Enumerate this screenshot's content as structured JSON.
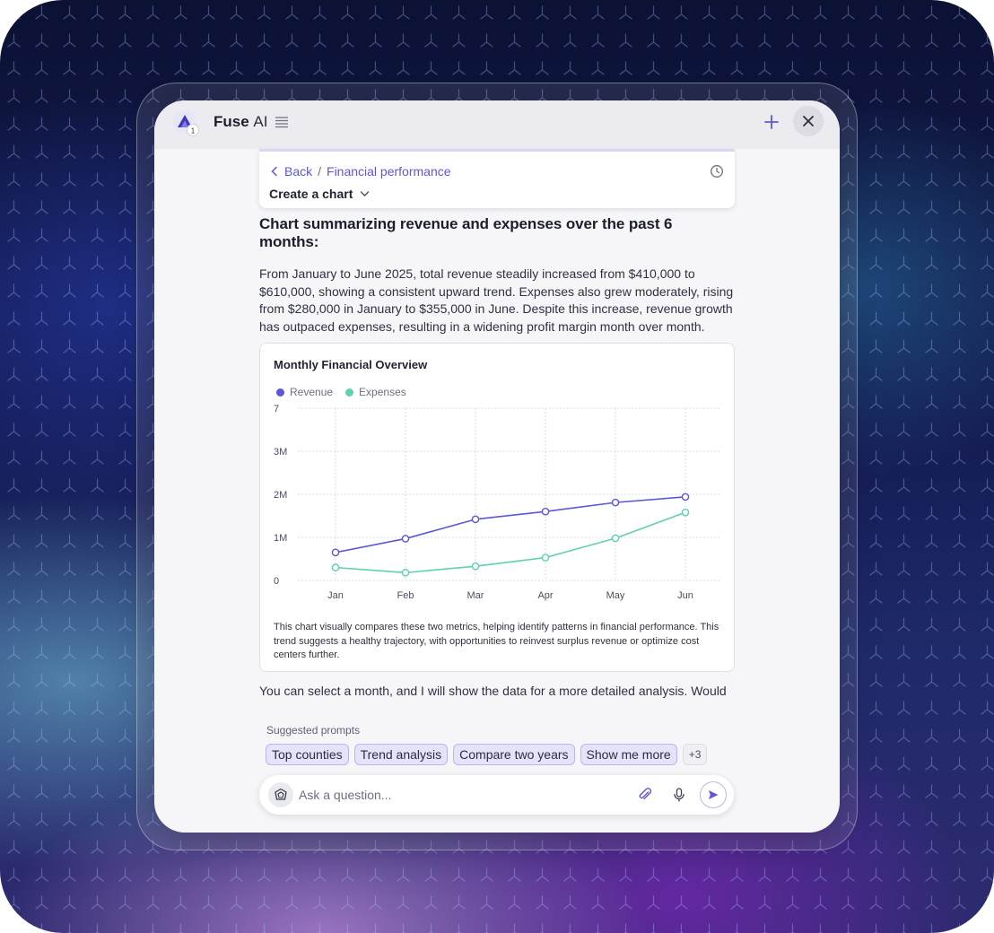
{
  "app": {
    "name_bold": "Fuse",
    "name_light": "AI",
    "logo_badge": "1"
  },
  "breadcrumb": {
    "back_label": "Back",
    "separator": "/",
    "current": "Financial performance",
    "subtitle": "Create a chart"
  },
  "message": {
    "heading": "Chart summarizing revenue and expenses over the past 6 months:",
    "paragraph": "From January to June 2025, total revenue steadily increased from $410,000 to $610,000, showing a consistent upward trend. Expenses also grew moderately, rising from $280,000 in January to $355,000 in June. Despite this increase, revenue growth has outpaced expenses, resulting in a widening profit margin month over month.",
    "followup": "You can select a month, and I will show the data for a more detailed analysis. Would"
  },
  "chart_data": {
    "type": "line",
    "title": "Monthly Financial Overview",
    "categories": [
      "Jan",
      "Feb",
      "Mar",
      "Apr",
      "May",
      "Jun"
    ],
    "series": [
      {
        "name": "Revenue",
        "color": "#5b57d6",
        "values": [
          0.65,
          0.97,
          1.42,
          1.6,
          1.81,
          1.94
        ]
      },
      {
        "name": "Expenses",
        "color": "#5fd0b0",
        "values": [
          0.3,
          0.18,
          0.33,
          0.53,
          0.98,
          1.58
        ]
      }
    ],
    "ylim": [
      0,
      4
    ],
    "yticks": [
      {
        "value": 0,
        "label": "0"
      },
      {
        "value": 1,
        "label": "1M"
      },
      {
        "value": 2,
        "label": "2M"
      },
      {
        "value": 3,
        "label": "3M"
      },
      {
        "value": 4,
        "label": "7"
      }
    ],
    "grid": true,
    "legend": "top-left",
    "caption": "This chart visually compares these two metrics, helping identify patterns in financial performance. This trend suggests a healthy trajectory, with opportunities to reinvest surplus revenue or optimize cost centers further."
  },
  "suggestions": {
    "label": "Suggested prompts",
    "chips": [
      "Top counties",
      "Trend analysis",
      "Compare two years",
      "Show me more"
    ],
    "more": "+3"
  },
  "input": {
    "placeholder": "Ask a question..."
  },
  "icons": {
    "logo": "fuse-logo-icon",
    "menu": "menu-lines-icon",
    "plus": "plus-icon",
    "close": "close-icon",
    "back": "chevron-left-icon",
    "history": "clock-icon",
    "dropdown": "chevron-down-icon",
    "input_left": "sparkle-icon",
    "attach": "paperclip-icon",
    "mic": "microphone-icon",
    "send": "send-icon"
  }
}
